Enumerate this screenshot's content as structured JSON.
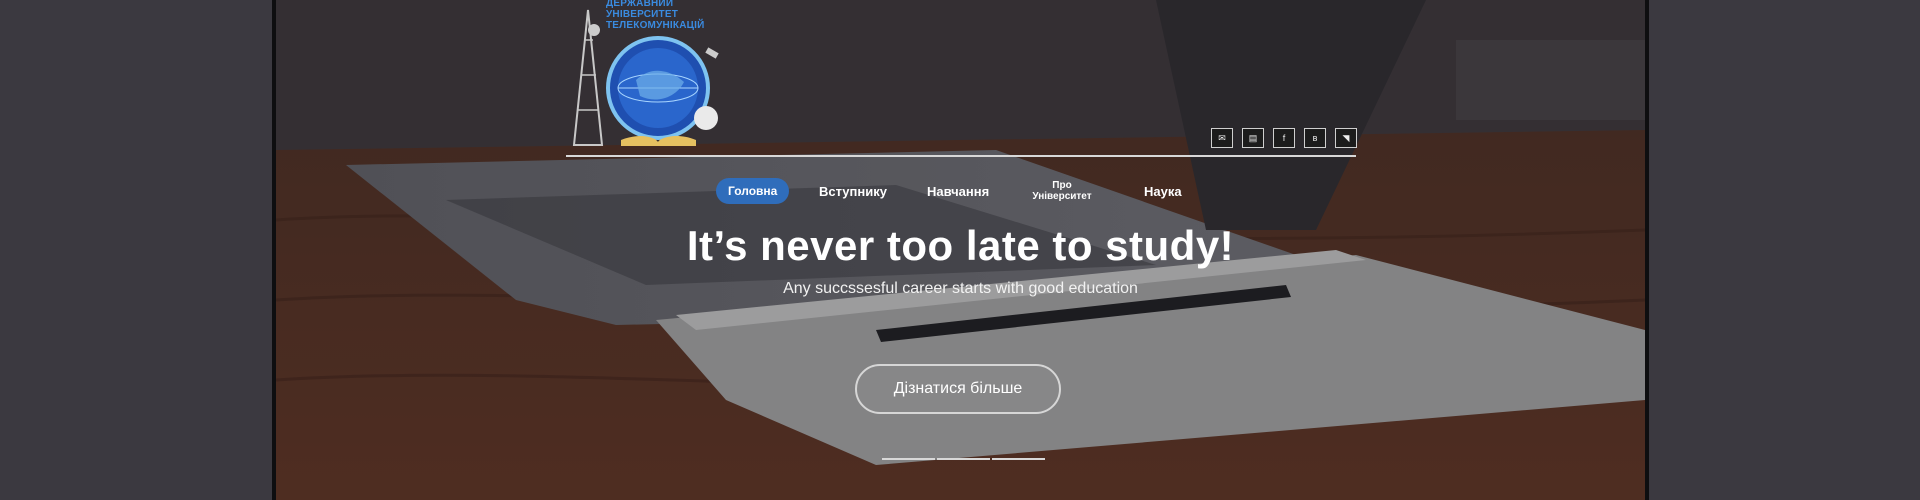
{
  "brand": {
    "logo_lines": [
      "ДЕРЖАВНИЙ",
      "УНІВЕРСИТЕТ",
      "ТЕЛЕКОМУНІКАЦІЙ"
    ]
  },
  "socials": [
    {
      "icon": "mail-icon",
      "glyph": "✉"
    },
    {
      "icon": "news-icon",
      "glyph": "▤"
    },
    {
      "icon": "facebook-icon",
      "glyph": "f"
    },
    {
      "icon": "vk-icon",
      "glyph": "в"
    },
    {
      "icon": "rss-icon",
      "glyph": "◥"
    }
  ],
  "nav": {
    "items": [
      {
        "label": "Головна",
        "active": true
      },
      {
        "label": "Вступнику"
      },
      {
        "label": "Навчання"
      },
      {
        "label": "Про Університет"
      },
      {
        "label": "Наука"
      }
    ]
  },
  "hero": {
    "title": "It’s never too late to study!",
    "subtitle": "Any succssesful career starts with good education",
    "cta_label": "Дізнатися більше"
  },
  "colors": {
    "accent": "#2f6dbb",
    "page_bg": "#3b3940"
  }
}
